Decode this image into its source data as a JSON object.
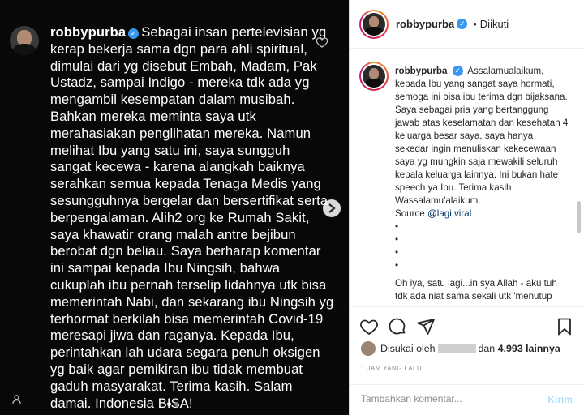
{
  "post_image": {
    "username": "robbypurba",
    "body": "Sebagai insan pertelevisian yg kerap bekerja sama dgn para ahli spiritual, dimulai dari yg disebut Embah, Madam, Pak Ustadz, sampai Indigo - mereka tdk ada yg mengambil kesempatan dalam musibah. Bahkan mereka meminta saya utk merahasiakan penglihatan mereka. Namun melihat Ibu yang satu ini, saya sungguh sangat kecewa - karena alangkah baiknya serahkan semua kepada Tenaga Medis yang sesungguhnya bergelar dan bersertifikat serta berpengalaman. Alih2 org ke Rumah Sakit, saya khawatir orang malah antre bejibun berobat dgn beliau. Saya berharap komentar ini sampai kepada Ibu Ningsih, bahwa cukuplah ibu pernah terselip lidahnya utk bisa memerintah Nabi, dan sekarang ibu Ningsih yg terhormat berkilah bisa memerintah Covid-19 meresapi jiwa dan raganya. Kepada Ibu, perintahkan lah udara segara penuh oksigen yg baik agar pemikiran ibu tidak membuat gaduh masyarakat. Terima kasih. Salam damai. Indonesia BISA!"
  },
  "header": {
    "username": "robbypurba",
    "separator": "•",
    "follow_status": "Diikuti"
  },
  "caption": {
    "username": "robbypurba",
    "text": "Assalamualaikum, kepada Ibu yang sangat saya hormati, semoga ini bisa ibu terima dgn bijaksana. Saya sebagai pria yang bertanggung jawab atas keselamatan dan kesehatan 4 keluarga besar saya, saya hanya sekedar ingin menuliskan kekecewaan saya yg mungkin saja mewakili seluruh kepala keluarga lainnya. Ini bukan hate speech ya Ibu. Terima kasih. Wassalamu'alaikum.",
    "source_prefix": "Source ",
    "source_link": "@lagi.viral",
    "bullets": [
      "•",
      "•",
      "•",
      "•"
    ],
    "more_text": "Oh iya, satu lagi...in sya Allah - aku tuh tdk ada niat sama sekali utk 'menutup"
  },
  "likes": {
    "prefix": "Disukai oleh",
    "middle": "dan",
    "count": "4,993 lainnya"
  },
  "timestamp": "1 JAM YANG LALU",
  "comment": {
    "placeholder": "Tambahkan komentar...",
    "post_label": "Kirim"
  },
  "icons": [
    "heart-icon",
    "reply-icon",
    "next-arrow-icon",
    "comment-icon",
    "share-icon",
    "bookmark-icon",
    "verified-icon"
  ],
  "colors": {
    "verified": "#3897f0",
    "post_button": "#b2dffc",
    "link": "#00376b"
  }
}
